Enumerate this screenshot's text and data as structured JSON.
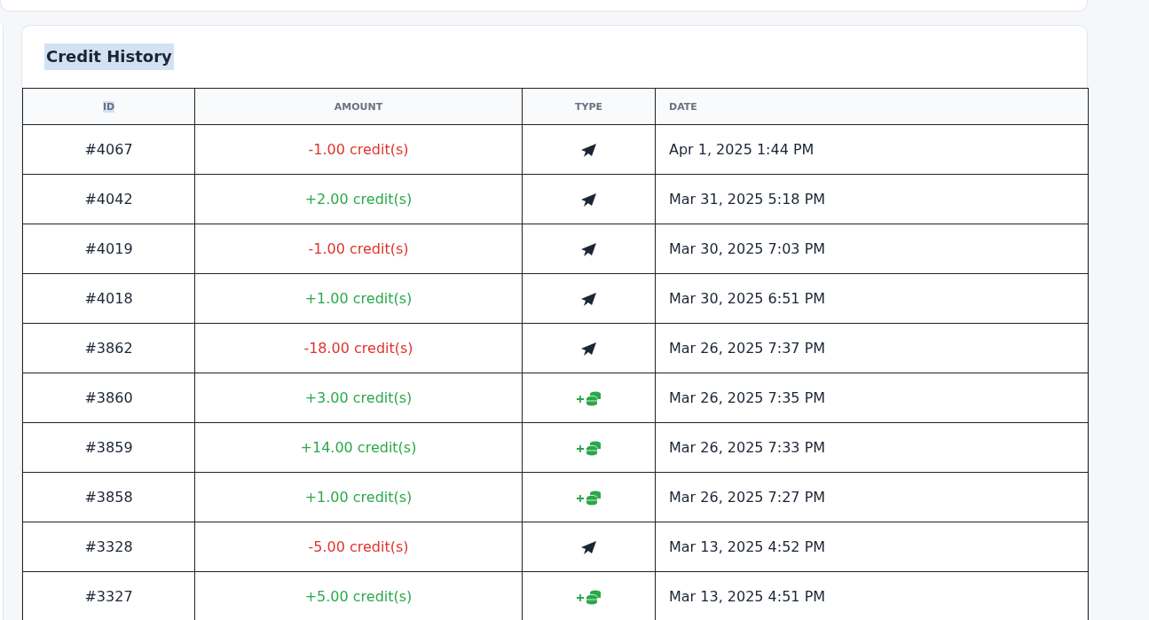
{
  "card": {
    "title": "Credit History",
    "title_highlighted": true
  },
  "table": {
    "columns": [
      {
        "label": "ID",
        "highlighted": true
      },
      {
        "label": "AMOUNT",
        "highlighted": false
      },
      {
        "label": "TYPE",
        "highlighted": false
      },
      {
        "label": "DATE",
        "highlighted": false
      }
    ],
    "rows": [
      {
        "id": "#4067",
        "amount": "-1.00 credit(s)",
        "color": "#e0342c",
        "kind": "sent",
        "date": "Apr 1, 2025 1:44 PM"
      },
      {
        "id": "#4042",
        "amount": "+2.00 credit(s)",
        "color": "#2aa84a",
        "kind": "sent",
        "date": "Mar 31, 2025 5:18 PM"
      },
      {
        "id": "#4019",
        "amount": "-1.00 credit(s)",
        "color": "#e0342c",
        "kind": "sent",
        "date": "Mar 30, 2025 7:03 PM"
      },
      {
        "id": "#4018",
        "amount": "+1.00 credit(s)",
        "color": "#2aa84a",
        "kind": "sent",
        "date": "Mar 30, 2025 6:51 PM"
      },
      {
        "id": "#3862",
        "amount": "-18.00 credit(s)",
        "color": "#e0342c",
        "kind": "sent",
        "date": "Mar 26, 2025 7:37 PM"
      },
      {
        "id": "#3860",
        "amount": "+3.00 credit(s)",
        "color": "#2aa84a",
        "kind": "purchase",
        "date": "Mar 26, 2025 7:35 PM"
      },
      {
        "id": "#3859",
        "amount": "+14.00 credit(s)",
        "color": "#2aa84a",
        "kind": "purchase",
        "date": "Mar 26, 2025 7:33 PM"
      },
      {
        "id": "#3858",
        "amount": "+1.00 credit(s)",
        "color": "#2aa84a",
        "kind": "purchase",
        "date": "Mar 26, 2025 7:27 PM"
      },
      {
        "id": "#3328",
        "amount": "-5.00 credit(s)",
        "color": "#e0342c",
        "kind": "sent",
        "date": "Mar 13, 2025 4:52 PM"
      },
      {
        "id": "#3327",
        "amount": "+5.00 credit(s)",
        "color": "#2aa84a",
        "kind": "purchase",
        "date": "Mar 13, 2025 4:51 PM"
      }
    ]
  }
}
